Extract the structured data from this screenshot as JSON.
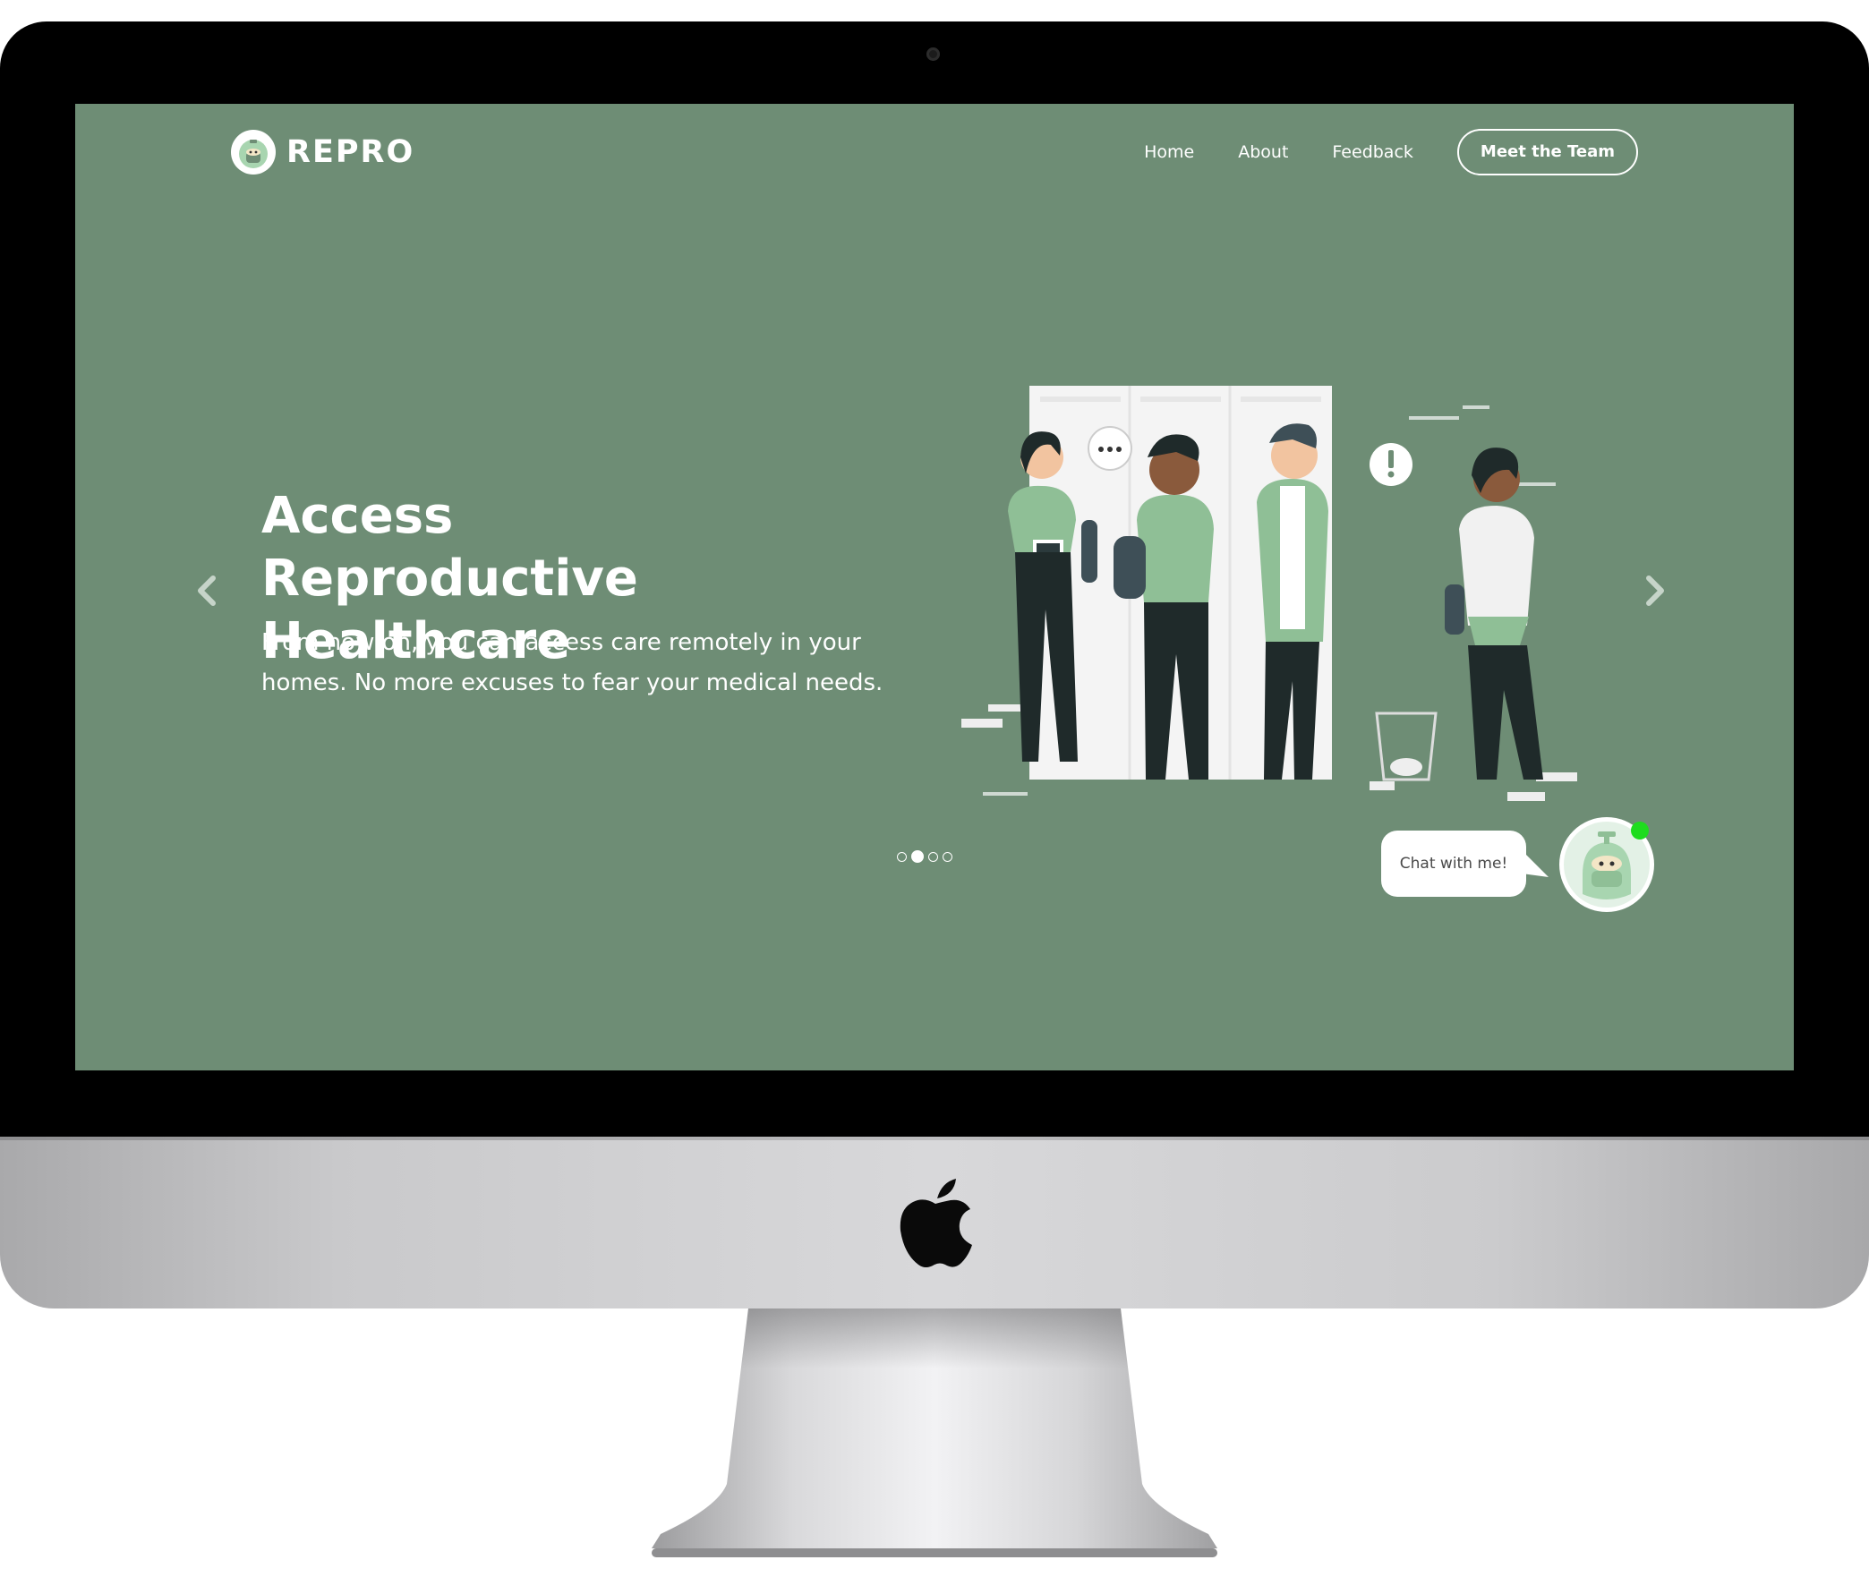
{
  "brand": {
    "name": "REPRO"
  },
  "nav": {
    "links": [
      "Home",
      "About",
      "Feedback"
    ],
    "cta_label": "Meet the Team"
  },
  "hero": {
    "title": "Access Reproductive Healthcare",
    "subtitle": "From now on, you can access care remotely in your homes. No more excuses to fear your medical needs."
  },
  "carousel": {
    "slide_count": 4,
    "active_index": 1
  },
  "chat": {
    "label": "Chat with me!",
    "online": true
  },
  "colors": {
    "background": "#6e8d75",
    "text": "#ffffff",
    "online_indicator": "#1edc1e"
  },
  "icons": [
    "chevron-left-icon",
    "chevron-right-icon",
    "apple-logo-icon",
    "chatbot-avatar-icon"
  ]
}
